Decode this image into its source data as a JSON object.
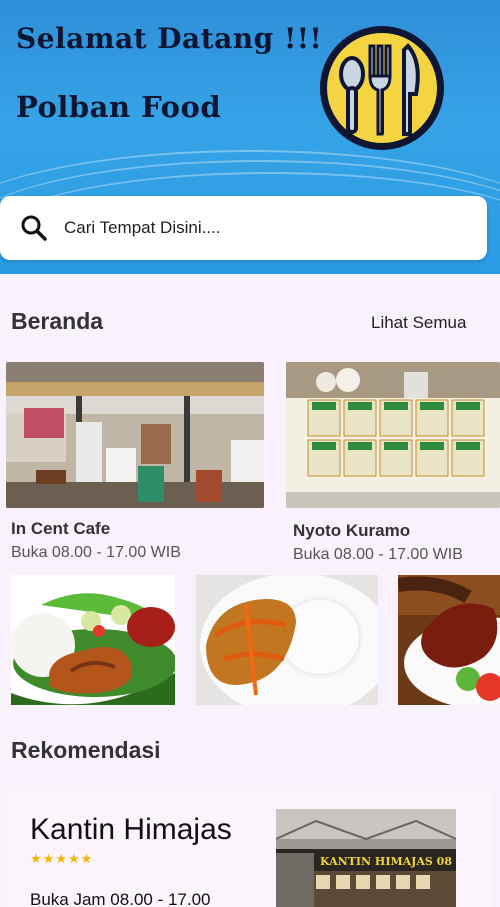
{
  "header": {
    "greeting": "Selamat Datang !!!",
    "brand": "Polban Food",
    "logo_icon": "fork-spoon-knife-icon"
  },
  "search": {
    "placeholder": "Cari Tempat Disini....",
    "icon": "search-icon"
  },
  "home": {
    "title": "Beranda",
    "see_all": "Lihat Semua",
    "places": [
      {
        "name": "In Cent Cafe",
        "hours": "Buka 08.00 - 17.00 WIB"
      },
      {
        "name": "Nyoto Kuramo",
        "hours": "Buka 08.00 - 17.00 WIB"
      }
    ]
  },
  "recommendation": {
    "title": "Rekomendasi",
    "name": "Kantin Himajas",
    "rating_stars": 5,
    "stars": "★★★★★",
    "hours": "Buka Jam 08.00 - 17.00",
    "sign_text": "KANTIN HIMAJAS 08"
  },
  "colors": {
    "header_blue": "#2f8fd8",
    "background": "#f9f1fb",
    "star": "#f4b400",
    "logo_yellow": "#f5d442"
  }
}
